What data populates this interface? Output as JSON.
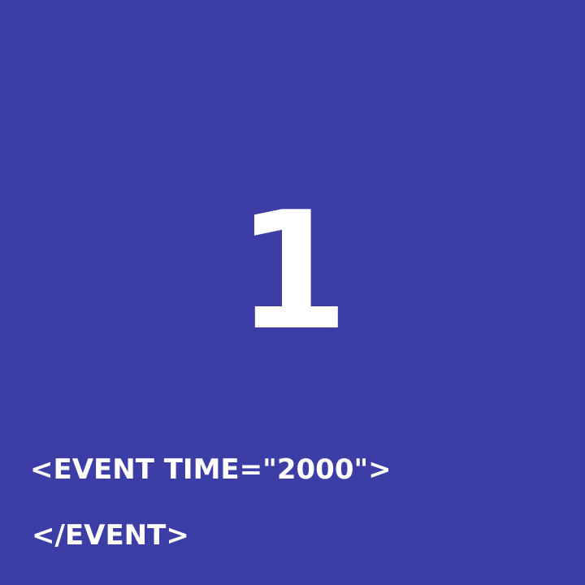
{
  "colors": {
    "background": "#3d3da6",
    "text": "#ffffff"
  },
  "display": {
    "number": "1"
  },
  "xml": {
    "open_tag": "<EVENT TIME=\"2000\">",
    "close_tag": "</EVENT>"
  }
}
